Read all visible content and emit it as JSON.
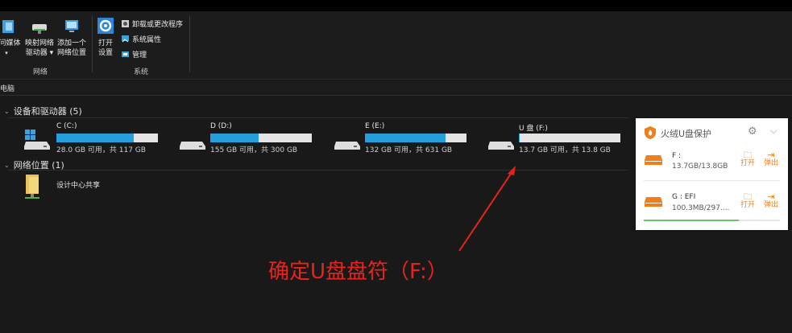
{
  "ribbon": {
    "media_label": "问媒体",
    "map_drive_label_1": "映射网络",
    "map_drive_label_2": "驱动器",
    "add_location_label_1": "添加一个",
    "add_location_label_2": "网络位置",
    "open_settings_label_1": "打开",
    "open_settings_label_2": "设置",
    "uninstall_label": "卸载或更改程序",
    "system_props_label": "系统属性",
    "manage_label": "管理",
    "group_network": "网络",
    "group_system": "系统"
  },
  "address": {
    "text": "电脑"
  },
  "devices": {
    "header": "设备和驱动器 (5)",
    "drives": [
      {
        "name": "C (C:)",
        "free": "28.0 GB 可用，共 117 GB",
        "used_fraction": 0.76
      },
      {
        "name": "D (D:)",
        "free": "155 GB 可用，共 300 GB",
        "used_fraction": 0.48
      },
      {
        "name": "E (E:)",
        "free": "132 GB 可用，共 631 GB",
        "used_fraction": 0.79
      },
      {
        "name": "U 盘 (F:)",
        "free": "13.7 GB 可用，共 13.8 GB",
        "used_fraction": 0.01
      }
    ]
  },
  "network": {
    "header": "网络位置 (1)",
    "item_label": "设计中心共享"
  },
  "usb_panel": {
    "title": "火绒U盘保护",
    "drives": [
      {
        "label": "F :",
        "size": "13.7GB/13.8GB",
        "open": "打开",
        "eject": "弹出"
      },
      {
        "label": "G : EFI",
        "size": "100.3MB/297....",
        "open": "打开",
        "eject": "弹出"
      }
    ],
    "accent": "#f07f1a"
  },
  "annotation": {
    "text": "确定U盘盘符（F:）"
  },
  "colors": {
    "bar_fill": "#26a0da",
    "annotation": "#e8231e"
  }
}
